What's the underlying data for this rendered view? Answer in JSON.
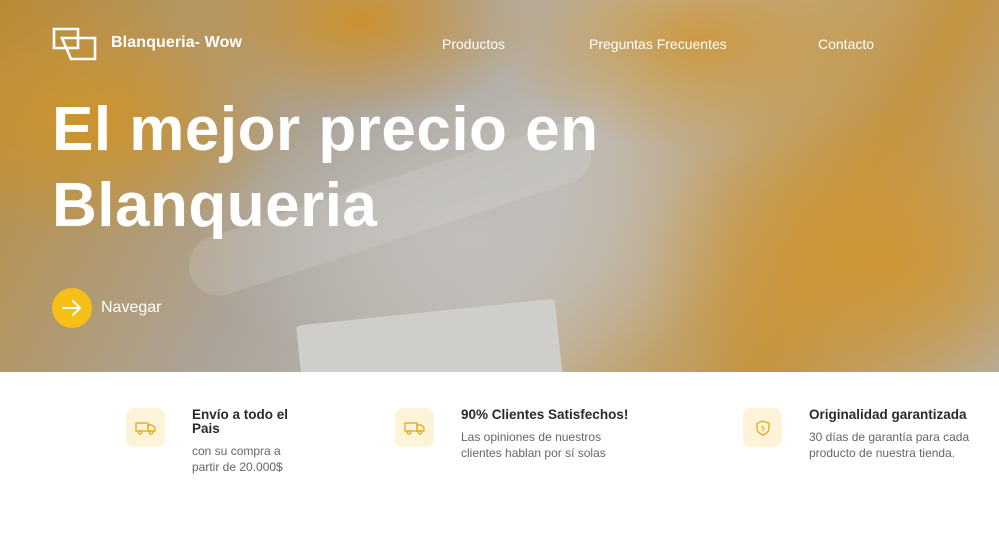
{
  "header": {
    "brand": "Blanqueria- Wow",
    "nav": [
      "Productos",
      "Preguntas Frecuentes",
      "Contacto"
    ]
  },
  "hero": {
    "headline_line1": "El mejor precio en",
    "headline_line2": "Blanqueria",
    "cta_label": "Navegar"
  },
  "features": [
    {
      "icon": "truck-icon",
      "title_line1": "Envío a todo el",
      "title_line2": "Pais",
      "desc_line1": "con su compra a",
      "desc_line2": "partir de 20.000$"
    },
    {
      "icon": "truck-icon",
      "title_line1": "90% Clientes Satisfechos!",
      "title_line2": "",
      "desc_line1": "Las opiniones de nuestros",
      "desc_line2": "clientes hablan por sí solas"
    },
    {
      "icon": "shield-dollar-icon",
      "title_line1": "Originalidad garantizada",
      "title_line2": "",
      "desc_line1": "30 días de garantía para cada",
      "desc_line2": "producto de nuestra tienda."
    }
  ],
  "colors": {
    "accent": "#f5bf17",
    "icon_bg": "#fdf3d9",
    "title": "#2a2a2a",
    "text": "#666666"
  }
}
